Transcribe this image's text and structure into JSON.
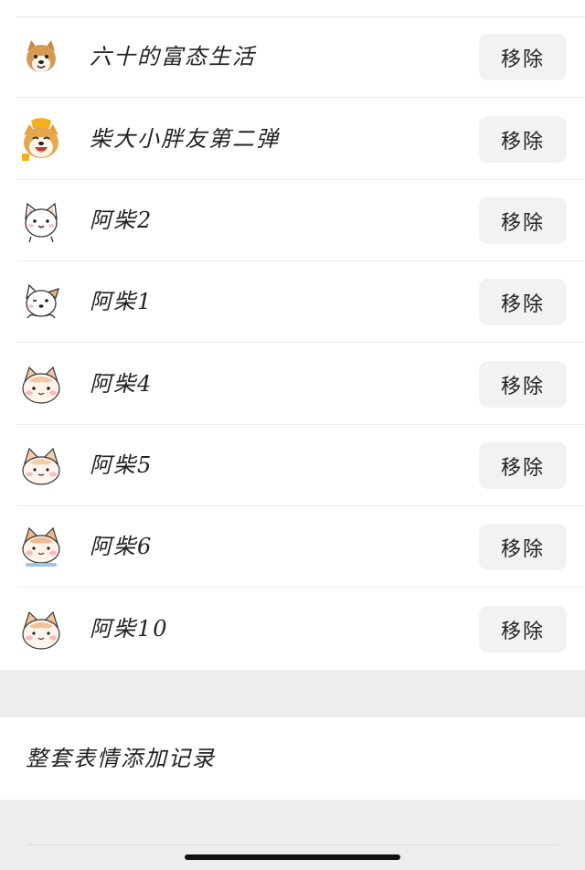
{
  "colors": {
    "button_bg": "#f2f2f2",
    "band_bg": "#ededed",
    "text": "#222222"
  },
  "stickers": [
    {
      "name": "六十的富态生活",
      "button": "移除",
      "icon": "shiba-photo-icon"
    },
    {
      "name": "柴大小胖友第二弹",
      "button": "移除",
      "icon": "shiba-smiling-photo-icon"
    },
    {
      "name": "阿柴2",
      "button": "移除",
      "icon": "cartoon-shiba-icon"
    },
    {
      "name": "阿柴1",
      "button": "移除",
      "icon": "cartoon-shiba-icon"
    },
    {
      "name": "阿柴4",
      "button": "移除",
      "icon": "cartoon-shiba-icon"
    },
    {
      "name": "阿柴5",
      "button": "移除",
      "icon": "cartoon-shiba-icon"
    },
    {
      "name": "阿柴6",
      "button": "移除",
      "icon": "cartoon-shiba-icon"
    },
    {
      "name": "阿柴10",
      "button": "移除",
      "icon": "cartoon-shiba-icon"
    }
  ],
  "history": {
    "label": "整套表情添加记录"
  }
}
